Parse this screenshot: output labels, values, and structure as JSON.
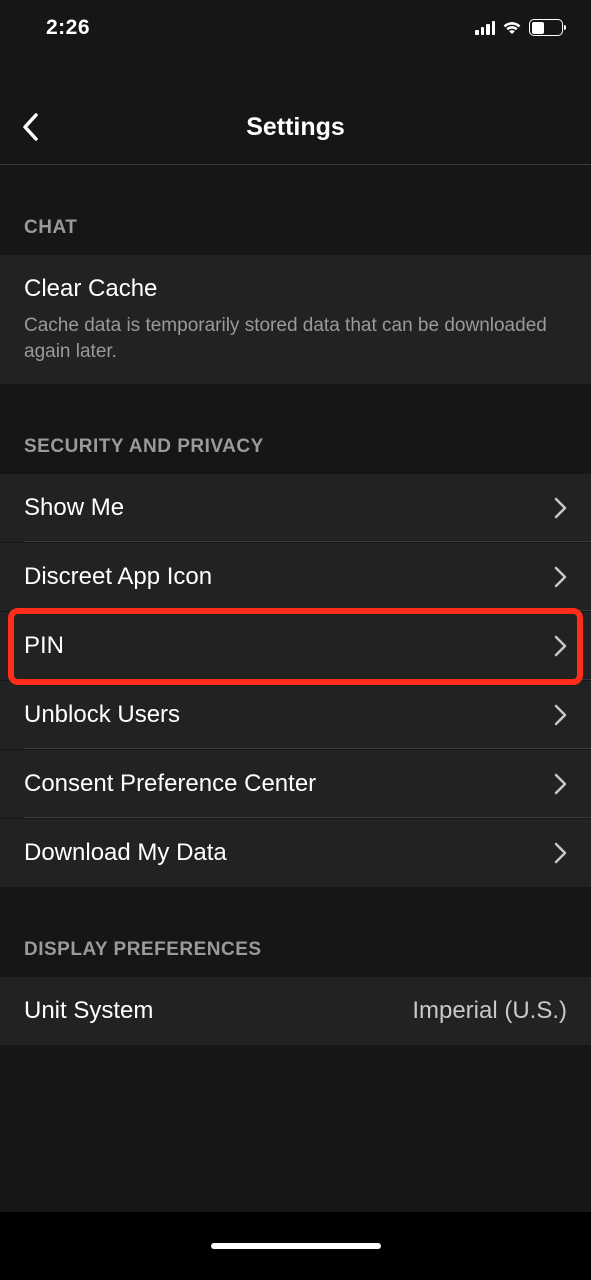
{
  "status": {
    "time": "2:26",
    "battery_percent": "38"
  },
  "nav": {
    "title": "Settings"
  },
  "sections": {
    "chat": {
      "header": "CHAT",
      "clear_cache": {
        "label": "Clear Cache",
        "description": "Cache data is temporarily stored data that can be downloaded again later."
      }
    },
    "security": {
      "header": "SECURITY AND PRIVACY",
      "show_me": "Show Me",
      "discreet_icon": "Discreet App Icon",
      "pin": "PIN",
      "unblock_users": "Unblock Users",
      "consent_center": "Consent Preference Center",
      "download_data": "Download My Data"
    },
    "display": {
      "header": "DISPLAY PREFERENCES",
      "unit_system": {
        "label": "Unit System",
        "value": "Imperial (U.S.)"
      }
    }
  }
}
